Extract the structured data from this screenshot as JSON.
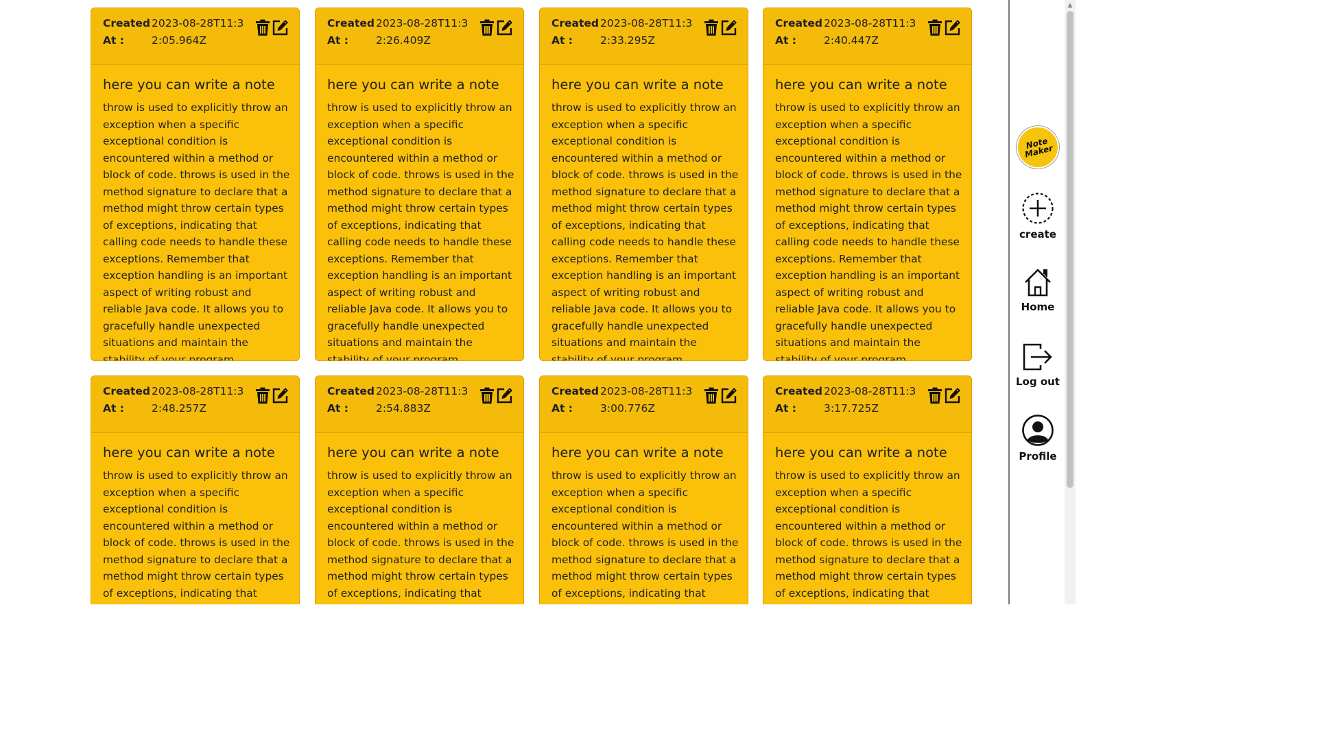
{
  "notes": [
    {
      "created_label": "Created At :",
      "created_at": "2023-08-28T11:32:05.964Z",
      "title": "here you can write a note",
      "body": "throw is used to explicitly throw an exception when a specific exceptional condition is encountered within a method or block of code. throws is used in the method signature to declare that a method might throw certain types of exceptions, indicating that calling code needs to handle these exceptions. Remember that exception handling is an important aspect of writing robust and reliable Java code. It allows you to gracefully handle unexpected situations and maintain the stability of your program."
    },
    {
      "created_label": "Created At :",
      "created_at": "2023-08-28T11:32:26.409Z",
      "title": "here you can write a note",
      "body": "throw is used to explicitly throw an exception when a specific exceptional condition is encountered within a method or block of code. throws is used in the method signature to declare that a method might throw certain types of exceptions, indicating that calling code needs to handle these exceptions. Remember that exception handling is an important aspect of writing robust and reliable Java code. It allows you to gracefully handle unexpected situations and maintain the stability of your program."
    },
    {
      "created_label": "Created At :",
      "created_at": "2023-08-28T11:32:33.295Z",
      "title": "here you can write a note",
      "body": "throw is used to explicitly throw an exception when a specific exceptional condition is encountered within a method or block of code. throws is used in the method signature to declare that a method might throw certain types of exceptions, indicating that calling code needs to handle these exceptions. Remember that exception handling is an important aspect of writing robust and reliable Java code. It allows you to gracefully handle unexpected situations and maintain the stability of your program."
    },
    {
      "created_label": "Created At :",
      "created_at": "2023-08-28T11:32:40.447Z",
      "title": "here you can write a note",
      "body": "throw is used to explicitly throw an exception when a specific exceptional condition is encountered within a method or block of code. throws is used in the method signature to declare that a method might throw certain types of exceptions, indicating that calling code needs to handle these exceptions. Remember that exception handling is an important aspect of writing robust and reliable Java code. It allows you to gracefully handle unexpected situations and maintain the stability of your program."
    },
    {
      "created_label": "Created At :",
      "created_at": "2023-08-28T11:32:48.257Z",
      "title": "here you can write a note",
      "body": "throw is used to explicitly throw an exception when a specific exceptional condition is encountered within a method or block of code. throws is used in the method signature to declare that a method might throw certain types of exceptions, indicating that calling code needs to handle"
    },
    {
      "created_label": "Created At :",
      "created_at": "2023-08-28T11:32:54.883Z",
      "title": "here you can write a note",
      "body": "throw is used to explicitly throw an exception when a specific exceptional condition is encountered within a method or block of code. throws is used in the method signature to declare that a method might throw certain types of exceptions, indicating that calling code needs to handle"
    },
    {
      "created_label": "Created At :",
      "created_at": "2023-08-28T11:33:00.776Z",
      "title": "here you can write a note",
      "body": "throw is used to explicitly throw an exception when a specific exceptional condition is encountered within a method or block of code. throws is used in the method signature to declare that a method might throw certain types of exceptions, indicating that calling code needs to handle"
    },
    {
      "created_label": "Created At :",
      "created_at": "2023-08-28T11:33:17.725Z",
      "title": "here you can write a note",
      "body": "throw is used to explicitly throw an exception when a specific exceptional condition is encountered within a method or block of code. throws is used in the method signature to declare that a method might throw certain types of exceptions, indicating that calling code needs to handle"
    }
  ],
  "card_icons": {
    "delete": "trash-icon",
    "edit": "edit-icon"
  },
  "sidebar": {
    "logo_text": "Note Maker",
    "create_label": "create",
    "home_label": "Home",
    "logout_label": "Log out",
    "profile_label": "Profile",
    "icons": [
      "plus-circle-icon",
      "home-icon",
      "logout-icon",
      "profile-icon"
    ]
  },
  "colors": {
    "card": "#fbc10a",
    "card_header": "#f5bb0b",
    "text": "#212121",
    "sidebar_divider": "#7a7a7a"
  }
}
